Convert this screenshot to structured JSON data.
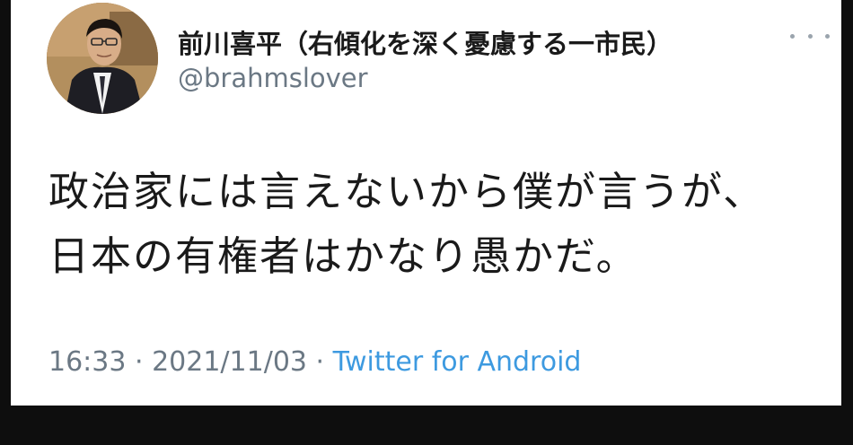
{
  "tweet": {
    "author": {
      "display_name": "前川喜平（右傾化を深く憂慮する一市民）",
      "handle": "@brahmslover",
      "avatar_icon": "user-avatar-photo"
    },
    "more_icon": "more-horizontal-icon",
    "text_lines": [
      "政治家には言えないから僕が言うが、",
      "日本の有権者はかなり愚かだ。"
    ],
    "time": "16:33",
    "separator1": " · ",
    "date": "2021/11/03",
    "separator2": " · ",
    "source": "Twitter for Android"
  },
  "colors": {
    "background": "#0e0e0e",
    "card": "#ffffff",
    "text": "#1a1a1a",
    "secondary": "#6b7884",
    "link": "#3d9ae0"
  }
}
